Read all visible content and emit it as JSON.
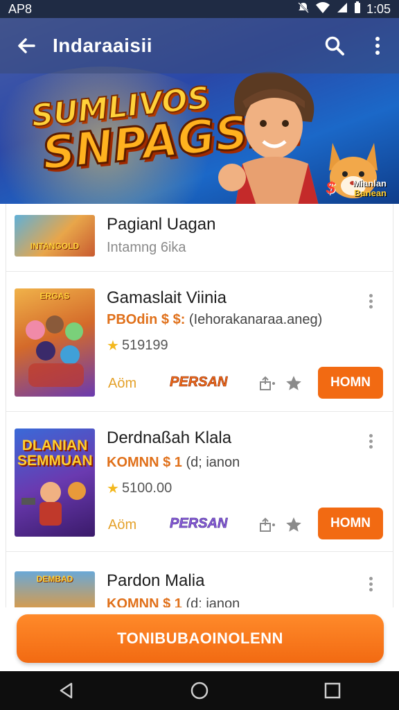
{
  "status_bar": {
    "left_text": "AP8",
    "time": "1:05"
  },
  "app_bar": {
    "title": "Indaraaisii"
  },
  "hero": {
    "title_line1": "SUMLIVOS",
    "title_line2": "SNPAGSIH",
    "badge_line1": "Mianlan",
    "badge_line2": "Banean",
    "badge_number": "$"
  },
  "list": {
    "items": [
      {
        "title": "Pagianl Uagan",
        "subtitle": "Intamng 6ika",
        "thumb_caption": "INTANGOLD"
      },
      {
        "title": "Gamaslait Viinia",
        "price_strong": "PBOdin $ $:",
        "price_rest": "(Iehorakanaraa.aneg)",
        "rating": "519199",
        "thumb_tag": "ERGAS",
        "add_label": "Aöm",
        "logo_text": "PERSAN",
        "button_label": "HOMN"
      },
      {
        "title": "Derdnaßah Klala",
        "price_strong": "KOMNN $ 1",
        "price_rest": "(d; ianon",
        "rating": "5100.00",
        "thumb_caption": "DLANIAN SEMMUAN",
        "add_label": "Aöm",
        "logo_text": "PERSAN",
        "button_label": "HOMN"
      },
      {
        "title": "Pardon Malia",
        "price_strong": "KOMNN $ 1",
        "price_rest": "(d; ianon",
        "thumb_tag": "DEMBAD"
      }
    ]
  },
  "bottom": {
    "main_button_label": "TONIBUBAOINOLENN"
  },
  "colors": {
    "accent": "#f26a12",
    "status_bar": "#1f2b44",
    "star": "#f3b81e"
  }
}
